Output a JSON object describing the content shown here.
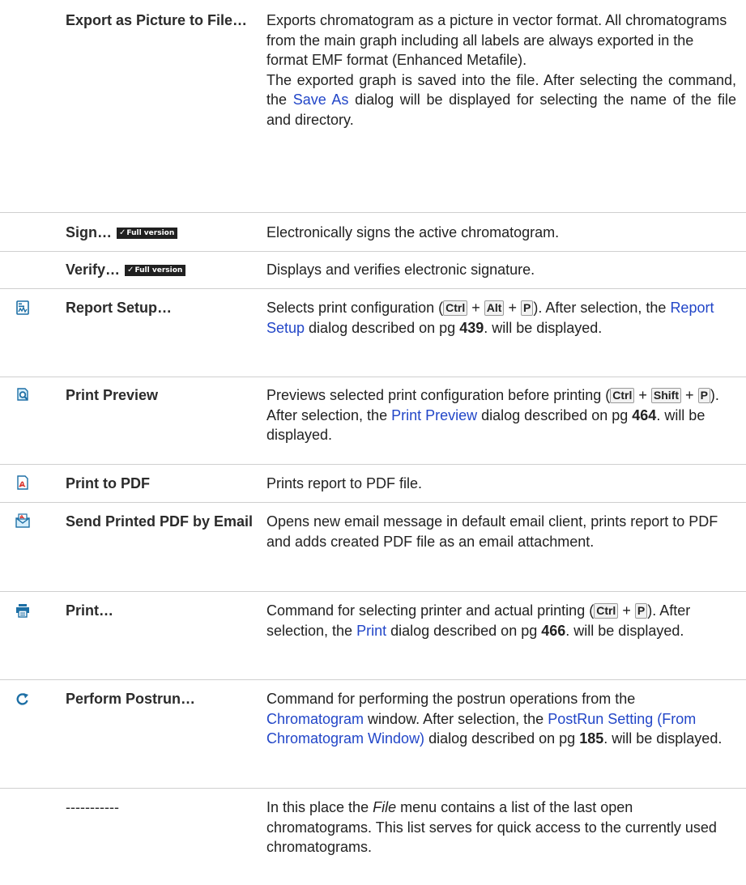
{
  "rows": [
    {
      "command": "Export as Picture to File…",
      "desc_1": "Exports chromatogram as a picture in vector format. All chromatograms from the main graph including all labels are always exported in the format EMF format (Enhanced Metafile).",
      "desc_2a": "The exported graph is saved into the file. After selecting the command, the ",
      "desc_2_link": "Save As",
      "desc_2b": " dialog will be displayed for selecting the name of the file and directory."
    },
    {
      "command": "Sign…",
      "badge": "Full version",
      "desc": "Electronically signs the active chromatogram."
    },
    {
      "command": "Verify…",
      "badge": "Full version",
      "desc": "Displays and verifies electronic signature."
    },
    {
      "icon": "report-setup-icon",
      "command": "Report Setup…",
      "desc_a": "Selects print configuration (",
      "key1": "Ctrl",
      "plus": "+",
      "key2": "Alt",
      "key3": "P",
      "desc_b": "). After selection, the ",
      "link": "Report Setup",
      "desc_c": " dialog described on pg ",
      "page": "439",
      "desc_d": ". will be displayed."
    },
    {
      "icon": "print-preview-icon",
      "command": "Print Preview",
      "desc_a": "Previews selected print configuration before printing (",
      "key1": "Ctrl",
      "key2": "Shift",
      "key3": "P",
      "desc_b": "). After selection, the ",
      "link": "Print Preview",
      "desc_c": " dialog described on pg ",
      "page": "464",
      "desc_d": ". will be displayed."
    },
    {
      "icon": "pdf-icon",
      "command": "Print to PDF",
      "desc": "Prints report to PDF file."
    },
    {
      "icon": "email-pdf-icon",
      "command": "Send Printed PDF by Email",
      "desc": "Opens new email message in default email client, prints report to PDF and adds created PDF file as an email attachment."
    },
    {
      "icon": "printer-icon",
      "command": "Print…",
      "desc_a": "Command for selecting printer and actual printing (",
      "key1": "Ctrl",
      "key2": "P",
      "desc_b": "). After selection, the ",
      "link": "Print",
      "desc_c": " dialog described on pg ",
      "page": "466",
      "desc_d": ". will be displayed."
    },
    {
      "icon": "postrun-icon",
      "command": "Perform Postrun…",
      "desc_a": "Command for performing the postrun operations from the ",
      "link1": "Chromatogram",
      "desc_b": " window. After selection, the ",
      "link2": "PostRun Setting (From Chromatogram Window)",
      "desc_c": " dialog described on pg ",
      "page": "185",
      "desc_d": ". will be displayed."
    },
    {
      "command": "-----------",
      "desc_a": "In this place the ",
      "italic": "File",
      "desc_b": " menu contains a list of the last open chromatograms. This list serves for quick access to the currently used chromatograms."
    }
  ],
  "colors": {
    "link": "#2246c8",
    "separator": "#cfcfcf",
    "icon_blue": "#1d6fa5",
    "icon_red": "#d9322b"
  }
}
